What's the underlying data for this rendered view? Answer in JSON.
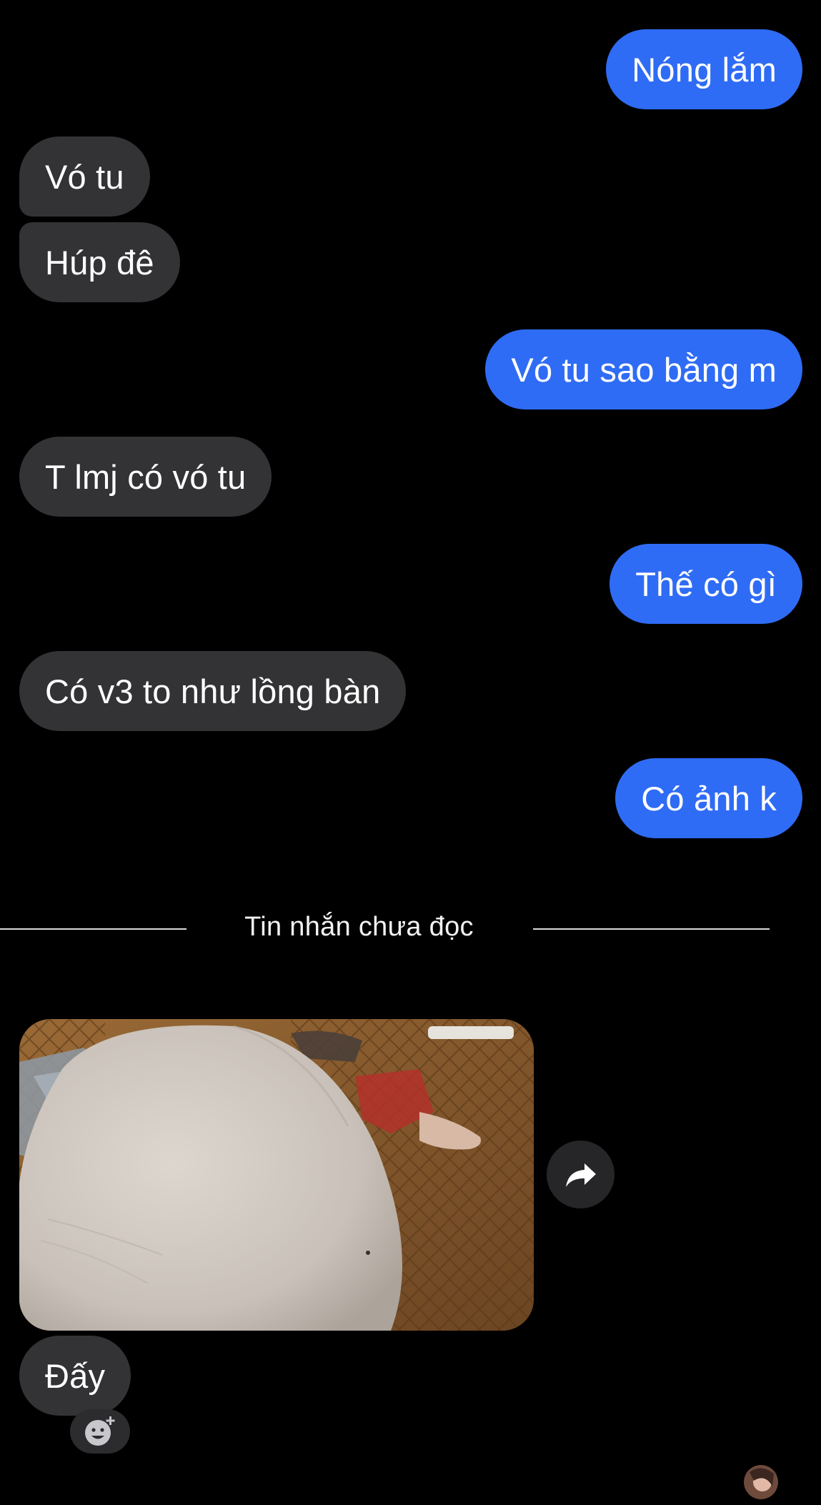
{
  "messages": [
    {
      "text": "Nóng lắm",
      "from": "me"
    },
    {
      "text": "Vó tu",
      "from": "other"
    },
    {
      "text": "Húp đê",
      "from": "other"
    },
    {
      "text": "Vó tu sao bằng m",
      "from": "me"
    },
    {
      "text": "T lmj có vó tu",
      "from": "other"
    },
    {
      "text": "Thế có gì",
      "from": "me"
    },
    {
      "text": "Có v3 to như lồng bàn",
      "from": "other"
    },
    {
      "text": "Có ảnh k",
      "from": "me"
    }
  ],
  "unread_divider": {
    "label": "Tin nhắn chưa đọc"
  },
  "after_divider": {
    "photo_icon": "photo-attachment",
    "share_icon": "share-forward-icon",
    "last_message": {
      "text": "Đấy",
      "from": "other"
    },
    "reaction_icon": "add-reaction-icon",
    "read_receipt_icon": "seen-avatar"
  },
  "colors": {
    "background": "#000000",
    "sent_bubble": "#2f6cf5",
    "received_bubble": "#333335",
    "text": "#ffffff"
  }
}
